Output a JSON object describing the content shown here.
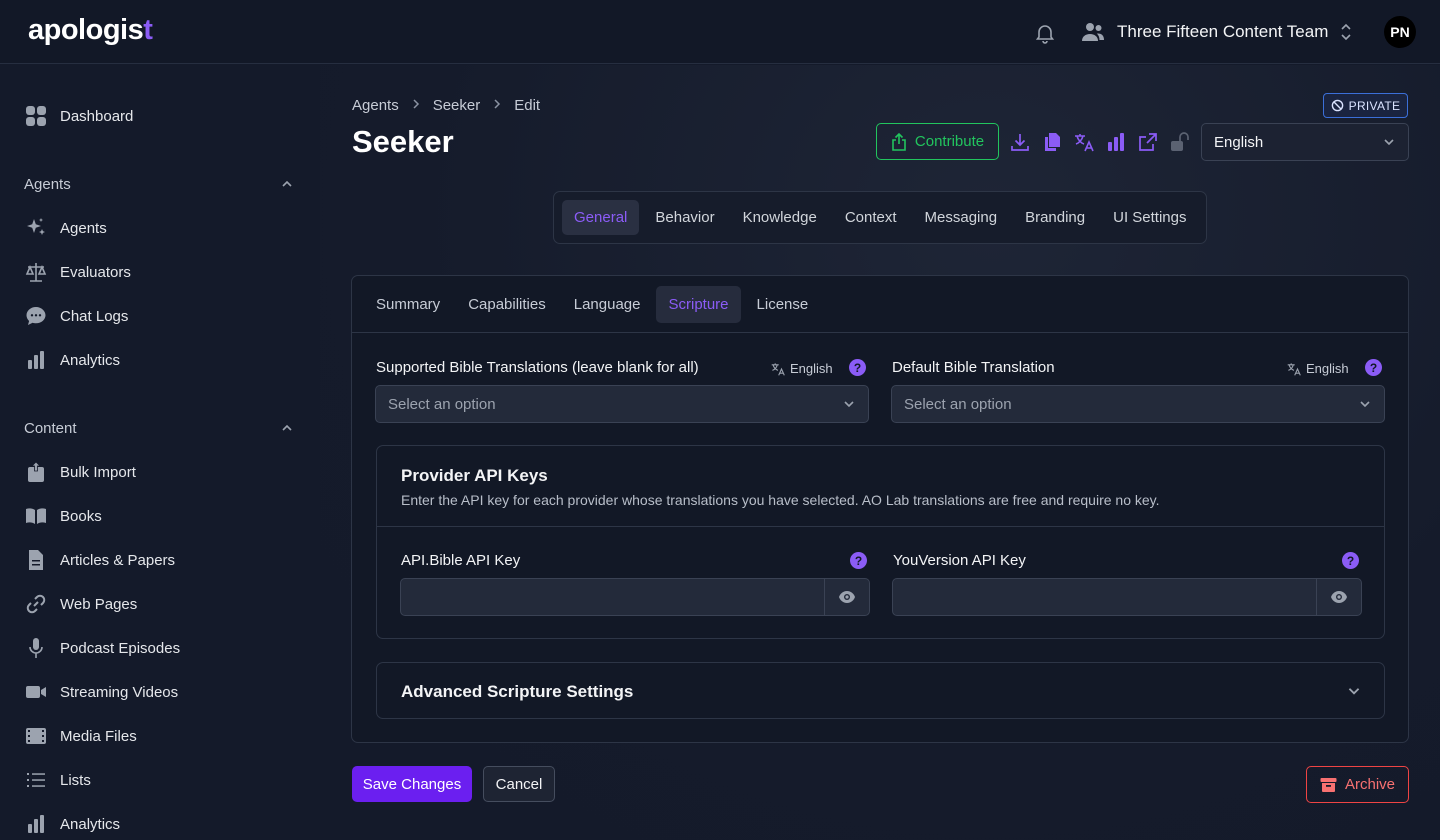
{
  "app": {
    "logo_text": "apologis",
    "logo_cross": "t"
  },
  "header": {
    "team_name": "Three Fifteen Content Team",
    "avatar_initials": "PN"
  },
  "sidebar": {
    "dashboard": "Dashboard",
    "agents_section": "Agents",
    "agents_items": [
      "Agents",
      "Evaluators",
      "Chat Logs",
      "Analytics"
    ],
    "content_section": "Content",
    "content_items": [
      "Bulk Import",
      "Books",
      "Articles & Papers",
      "Web Pages",
      "Podcast Episodes",
      "Streaming Videos",
      "Media Files",
      "Lists",
      "Analytics"
    ]
  },
  "breadcrumb": [
    "Agents",
    "Seeker",
    "Edit"
  ],
  "page": {
    "title": "Seeker",
    "privacy_badge": "PRIVATE",
    "contribute_label": "Contribute",
    "language_value": "English"
  },
  "main_tabs": [
    "General",
    "Behavior",
    "Knowledge",
    "Context",
    "Messaging",
    "Branding",
    "UI Settings"
  ],
  "sub_tabs": [
    "Summary",
    "Capabilities",
    "Language",
    "Scripture",
    "License"
  ],
  "scripture": {
    "supported_label": "Supported Bible Translations (leave blank for all)",
    "supported_lang": "English",
    "supported_placeholder": "Select an option",
    "default_label": "Default Bible Translation",
    "default_lang": "English",
    "default_placeholder": "Select an option",
    "keys_title": "Provider API Keys",
    "keys_desc": "Enter the API key for each provider whose translations you have selected. AO Lab translations are free and require no key.",
    "api_bible_label": "API.Bible API Key",
    "youversion_label": "YouVersion API Key",
    "advanced_title": "Advanced Scripture Settings"
  },
  "actions": {
    "save": "Save Changes",
    "cancel": "Cancel",
    "archive": "Archive"
  },
  "colors": {
    "accent": "#8b5cf6",
    "primary_button": "#6b1ff0",
    "success": "#22c55e",
    "danger": "#ef4444"
  }
}
